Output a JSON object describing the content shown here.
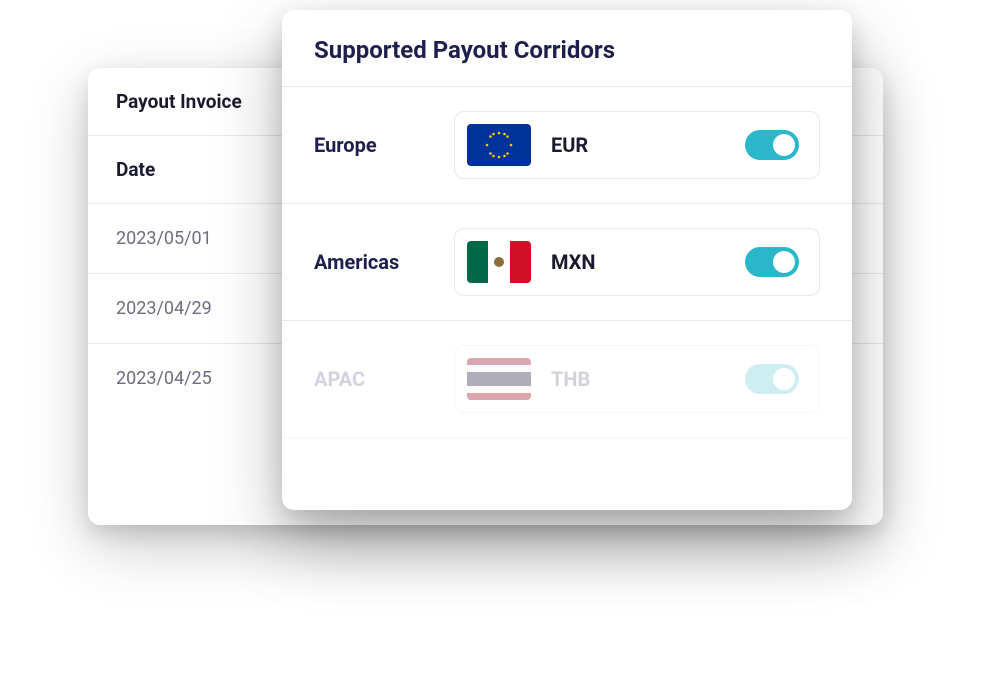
{
  "back_card": {
    "title": "Payout Invoice",
    "column_header": "Date",
    "rows": [
      "2023/05/01",
      "2023/04/29",
      "2023/04/25"
    ]
  },
  "front_card": {
    "title": "Supported Payout Corridors",
    "corridors": [
      {
        "region": "Europe",
        "currency": "EUR",
        "flag": "eu",
        "enabled": true,
        "faded": false
      },
      {
        "region": "Americas",
        "currency": "MXN",
        "flag": "mx",
        "enabled": true,
        "faded": false
      },
      {
        "region": "APAC",
        "currency": "THB",
        "flag": "th",
        "enabled": true,
        "faded": true
      }
    ]
  },
  "colors": {
    "accent": "#2ab7ca",
    "heading": "#1f1f4d"
  }
}
